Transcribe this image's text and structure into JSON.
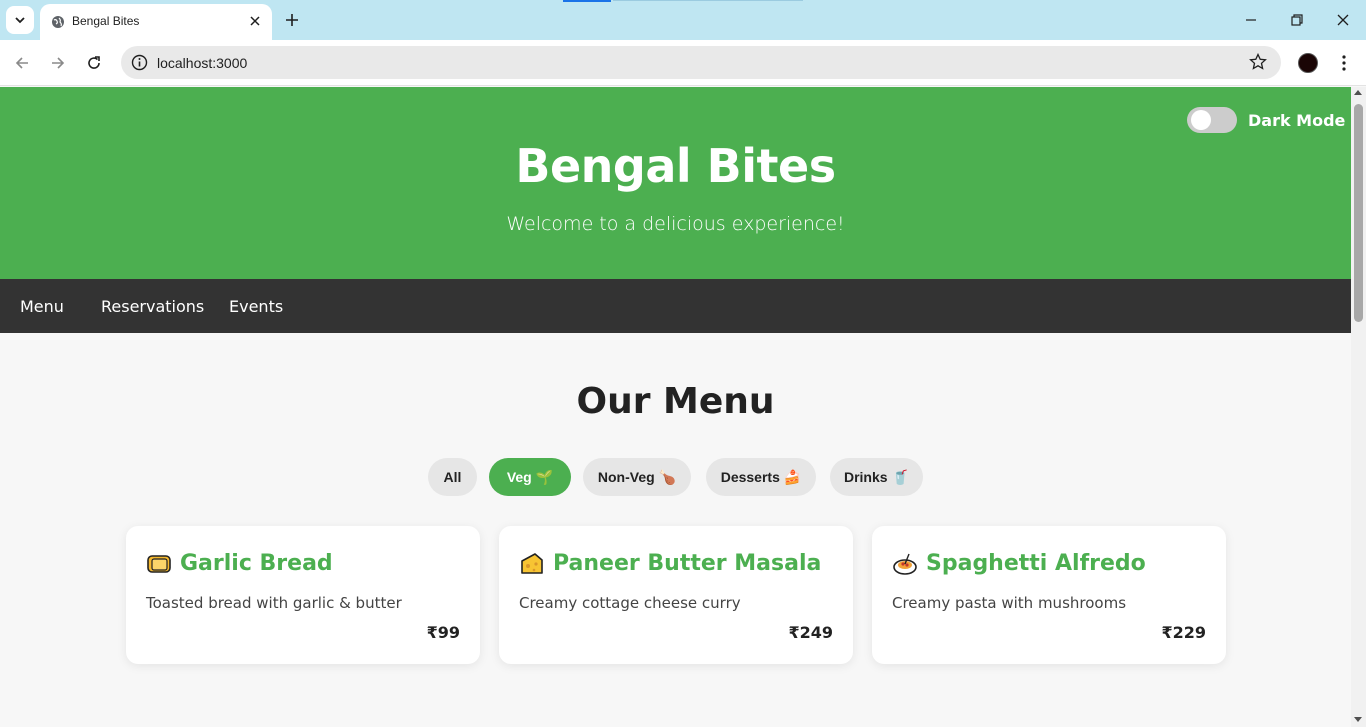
{
  "browser": {
    "tab_title": "Bengal Bites",
    "url": "localhost:3000",
    "icons": {
      "tab_search": "chevron-down-icon",
      "favicon": "globe-icon",
      "close_tab": "close-icon",
      "new_tab": "plus-icon",
      "back": "arrow-left-icon",
      "forward": "arrow-right-icon",
      "reload": "reload-icon",
      "site_info": "info-icon",
      "bookmark": "star-icon",
      "menu": "kebab-icon"
    }
  },
  "header": {
    "title": "Bengal Bites",
    "tagline": "Welcome to a delicious experience!",
    "dark_mode_label": "Dark Mode",
    "dark_mode_on": false
  },
  "nav": {
    "items": [
      {
        "label": "Menu"
      },
      {
        "label": "Reservations"
      },
      {
        "label": "Events"
      }
    ]
  },
  "menu": {
    "title": "Our Menu",
    "filters": [
      {
        "label": "All",
        "emoji": "",
        "active": false
      },
      {
        "label": "Veg",
        "emoji": "🌱",
        "active": true
      },
      {
        "label": "Non-Veg",
        "emoji": "🍗",
        "active": false
      },
      {
        "label": "Desserts",
        "emoji": "🍰",
        "active": false
      },
      {
        "label": "Drinks",
        "emoji": "🥤",
        "active": false
      }
    ],
    "items": [
      {
        "icon": "bread-icon",
        "name": "Garlic Bread",
        "description": "Toasted bread with garlic & butter",
        "price": "₹99"
      },
      {
        "icon": "cheese-icon",
        "name": "Paneer Butter Masala",
        "description": "Creamy cottage cheese curry",
        "price": "₹249"
      },
      {
        "icon": "spaghetti-icon",
        "name": "Spaghetti Alfredo",
        "description": "Creamy pasta with mushrooms",
        "price": "₹229"
      }
    ]
  },
  "colors": {
    "brand_green": "#4caf50",
    "nav_bg": "#333333",
    "page_bg": "#f7f7f7"
  }
}
